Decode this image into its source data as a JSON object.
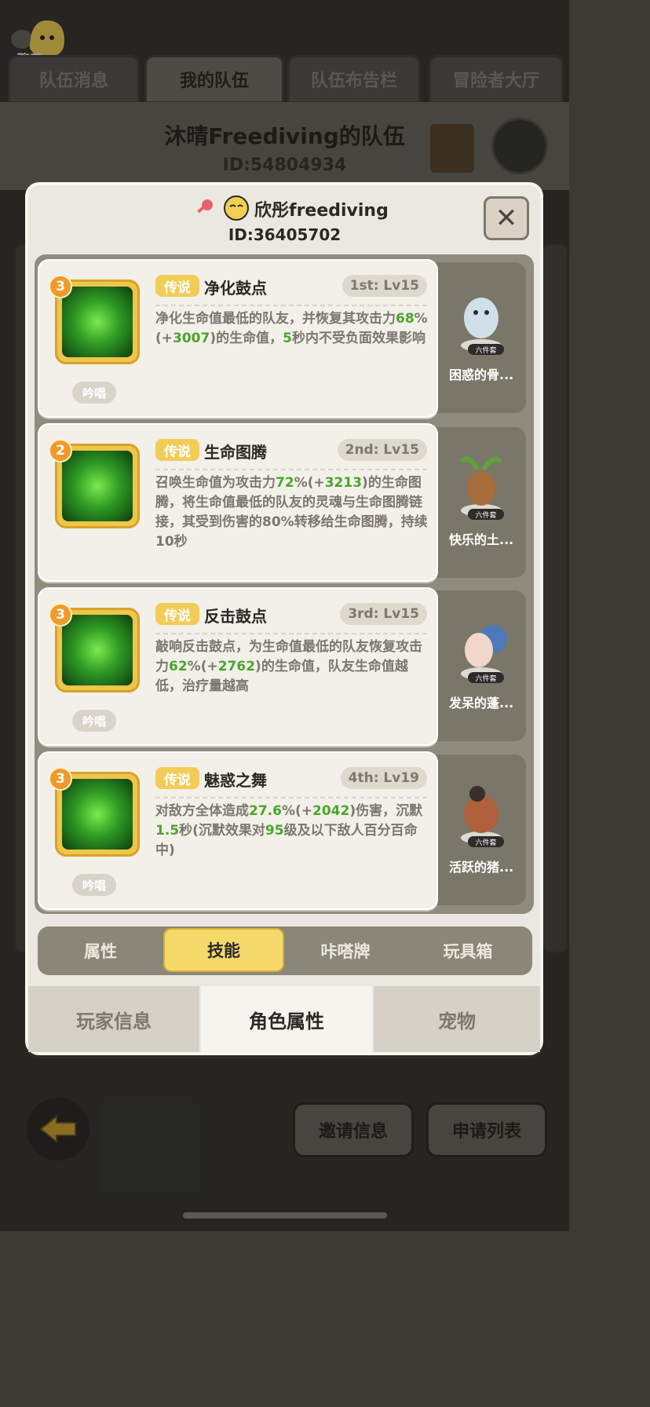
{
  "chat": {
    "label": "聊天"
  },
  "top_tabs": [
    {
      "label": "队伍消息"
    },
    {
      "label": "我的队伍"
    },
    {
      "label": "队伍布告栏"
    },
    {
      "label": "冒险者大厅"
    }
  ],
  "team": {
    "title": "沐晴Freediving的队伍",
    "id": "ID:54804934"
  },
  "player": {
    "name": "欣彤freediving",
    "id": "ID:36405702"
  },
  "close": {
    "label": "✕"
  },
  "skills": [
    {
      "level": "3",
      "tag": "传说",
      "name": "净化鼓点",
      "rank": "1st: Lv15",
      "desc_parts": [
        "净化生命值最低的队友，并恢复其攻击力",
        "68",
        "%(+",
        "3007",
        ")的生命值，",
        "5",
        "秒内不受负面效果影响"
      ],
      "chant": "吟唱"
    },
    {
      "level": "2",
      "tag": "传说",
      "name": "生命图腾",
      "rank": "2nd: Lv15",
      "desc_parts": [
        "召唤生命值为攻击力",
        "72",
        "%(+",
        "3213",
        ")的生命图腾，将生命值最低的队友的灵魂与生命图腾链接，其受到伤害的80%转移给生命图腾，持续10秒"
      ],
      "chant": ""
    },
    {
      "level": "3",
      "tag": "传说",
      "name": "反击鼓点",
      "rank": "3rd: Lv15",
      "desc_parts": [
        "敲响反击鼓点，为生命值最低的队友恢复攻击力",
        "62",
        "%(+",
        "2762",
        ")的生命值，队友生命值越低，治疗量越高"
      ],
      "chant": "吟唱"
    },
    {
      "level": "3",
      "tag": "传说",
      "name": "魅惑之舞",
      "rank": "4th: Lv19",
      "desc_parts": [
        "对敌方全体造成",
        "27.6",
        "%(+",
        "2042",
        ")伤害，沉默",
        "1.5",
        "秒(沉默效果对",
        "95",
        "级及以下敌人百分百命中)"
      ],
      "chant": "吟唱"
    }
  ],
  "costumes": [
    {
      "badge": "六件套",
      "name": "困惑的骨..."
    },
    {
      "badge": "六件套",
      "name": "快乐的土..."
    },
    {
      "badge": "六件套",
      "name": "发呆的蓬..."
    },
    {
      "badge": "六件套",
      "name": "活跃的猪..."
    }
  ],
  "sub_tabs": [
    {
      "label": "属性"
    },
    {
      "label": "技能"
    },
    {
      "label": "咔嗒牌"
    },
    {
      "label": "玩具箱"
    }
  ],
  "bottom_tabs": [
    {
      "label": "玩家信息"
    },
    {
      "label": "角色属性"
    },
    {
      "label": "宠物"
    }
  ],
  "actions": {
    "invite": "邀请信息",
    "apply": "申请列表"
  },
  "colors": {
    "legend_tag": "#f1cd58",
    "highlight_green": "#4aa52c",
    "active_tab": "#f5d96b"
  }
}
